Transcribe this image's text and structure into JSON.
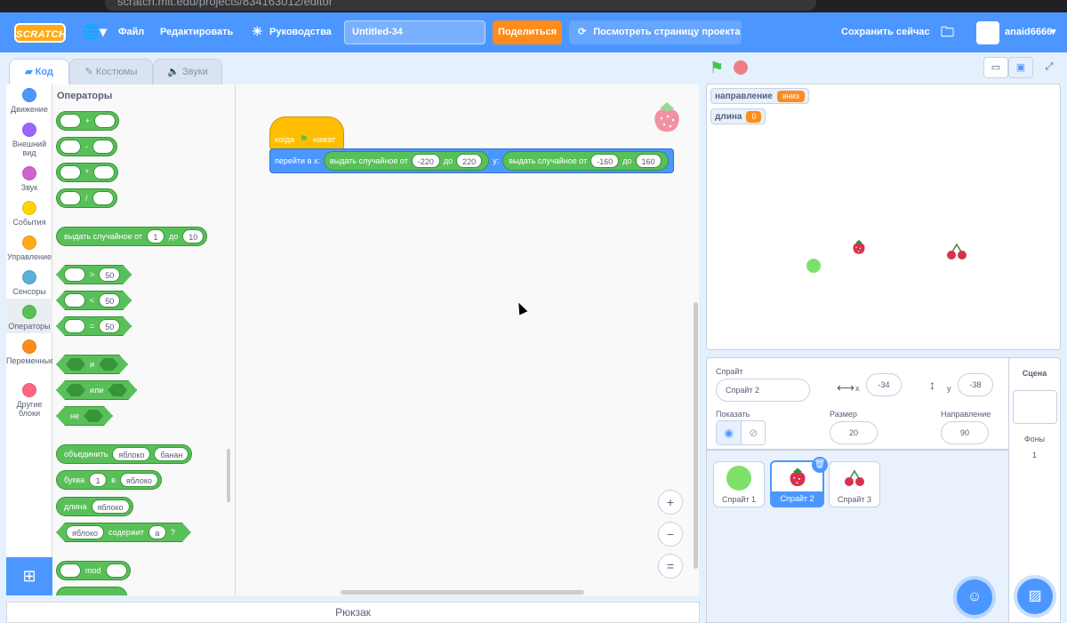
{
  "browser": {
    "url": "scratch.mit.edu/projects/834163012/editor"
  },
  "menubar": {
    "logo": "SCRATCH",
    "file": "Файл",
    "edit": "Редактировать",
    "tutorials": "Руководства",
    "project_title": "Untitled-34",
    "share": "Поделиться",
    "see_project": "Посмотреть страницу проекта",
    "save_now": "Сохранить сейчас",
    "username": "anaid6666"
  },
  "tabs": {
    "code": "Код",
    "costumes": "Костюмы",
    "sounds": "Звуки"
  },
  "categories": [
    {
      "label": "Движение",
      "color": "#4c97ff"
    },
    {
      "label": "Внешний вид",
      "color": "#9966ff"
    },
    {
      "label": "Звук",
      "color": "#cf63cf"
    },
    {
      "label": "События",
      "color": "#ffd500"
    },
    {
      "label": "Управление",
      "color": "#ffab19"
    },
    {
      "label": "Сенсоры",
      "color": "#5cb1d6"
    },
    {
      "label": "Операторы",
      "color": "#59c059"
    },
    {
      "label": "Переменные",
      "color": "#ff8c1a"
    },
    {
      "label": "Другие блоки",
      "color": "#ff6680"
    }
  ],
  "palette": {
    "title": "Операторы",
    "plus": "+",
    "minus": "-",
    "times": "*",
    "divide": "/",
    "random_label": "выдать случайное от",
    "random_from": "1",
    "random_to_label": "до",
    "random_to": "10",
    "gt": ">",
    "lt": "<",
    "eq": "=",
    "cmp_value": "50",
    "and": "и",
    "or": "или",
    "not": "не",
    "join_label": "объединить",
    "join_a": "яблоко",
    "join_b": "банан",
    "letter_label": "буква",
    "letter_index": "1",
    "letter_of": "в",
    "letter_word": "яблоко",
    "length_label": "длина",
    "length_word": "яблоко",
    "contains_word": "яблоко",
    "contains_label": "содержит",
    "contains_char": "а",
    "contains_q": "?",
    "mod": "mod"
  },
  "script": {
    "hat_when": "когда",
    "hat_clicked": "нажат",
    "goto_label": "перейти в x:",
    "rand_label": "выдать случайное от",
    "to_label": "до",
    "y_label": "y:",
    "x_from": "-220",
    "x_to": "220",
    "y_from": "-160",
    "y_to": "160"
  },
  "zoom": {
    "in": "+",
    "out": "−",
    "reset": "="
  },
  "backpack": "Рюкзак",
  "stage": {
    "monitors": [
      {
        "label": "направление",
        "value": "вниз"
      },
      {
        "label": "длина",
        "value": "0"
      }
    ]
  },
  "sprite_info": {
    "sprite_label": "Спрайт",
    "sprite_name": "Спрайт 2",
    "x_label": "x",
    "x_value": "-34",
    "y_label": "y",
    "y_value": "-38",
    "show_label": "Показать",
    "size_label": "Размер",
    "size_value": "20",
    "direction_label": "Направление",
    "direction_value": "90"
  },
  "sprites": [
    {
      "name": "Спрайт 1"
    },
    {
      "name": "Спрайт 2"
    },
    {
      "name": "Спрайт 3"
    }
  ],
  "stage_pane": {
    "title": "Сцена",
    "backdrops_label": "Фоны",
    "backdrops_count": "1"
  }
}
